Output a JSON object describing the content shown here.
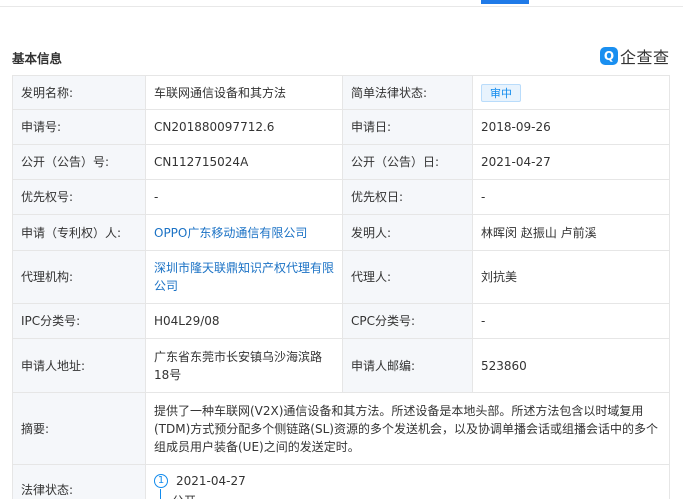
{
  "section": {
    "title": "基本信息",
    "logo_mark": "Q",
    "logo_text": "企查查"
  },
  "rows": {
    "invention_name_label": "发明名称:",
    "invention_name": "车联网通信设备和其方法",
    "legal_status_label": "简单法律状态:",
    "legal_status": "审中",
    "application_no_label": "申请号:",
    "application_no": "CN201880097712.6",
    "application_date_label": "申请日:",
    "application_date": "2018-09-26",
    "publication_no_label": "公开（公告）号:",
    "publication_no": "CN112715024A",
    "publication_date_label": "公开（公告）日:",
    "publication_date": "2021-04-27",
    "priority_no_label": "优先权号:",
    "priority_no": "-",
    "priority_date_label": "优先权日:",
    "priority_date": "-",
    "applicant_label": "申请（专利权）人:",
    "applicant": "OPPO广东移动通信有限公司",
    "inventor_label": "发明人:",
    "inventor": "林晖闵 赵振山 卢前溪",
    "agency_label": "代理机构:",
    "agency": "深圳市隆天联鼎知识产权代理有限公司",
    "agent_label": "代理人:",
    "agent": "刘抗美",
    "ipc_label": "IPC分类号:",
    "ipc": "H04L29/08",
    "cpc_label": "CPC分类号:",
    "cpc": "-",
    "address_label": "申请人地址:",
    "address": "广东省东莞市长安镇乌沙海滨路18号",
    "postcode_label": "申请人邮编:",
    "postcode": "523860",
    "abstract_label": "摘要:",
    "abstract": "提供了一种车联网(V2X)通信设备和其方法。所述设备是本地头部。所述方法包含以时域复用(TDM)方式预分配多个侧链路(SL)资源的多个发送机会，以及协调单播会话或组播会话中的多个组成员用户装备(UE)之间的发送定时。",
    "legal_label": "法律状态:"
  },
  "timeline": {
    "step": "1",
    "date": "2021-04-27",
    "next": "公开"
  },
  "colors": {
    "accent": "#128bed",
    "link": "#1b72c5",
    "label_bg": "#f5f7fa",
    "border": "#e6e6e6"
  }
}
